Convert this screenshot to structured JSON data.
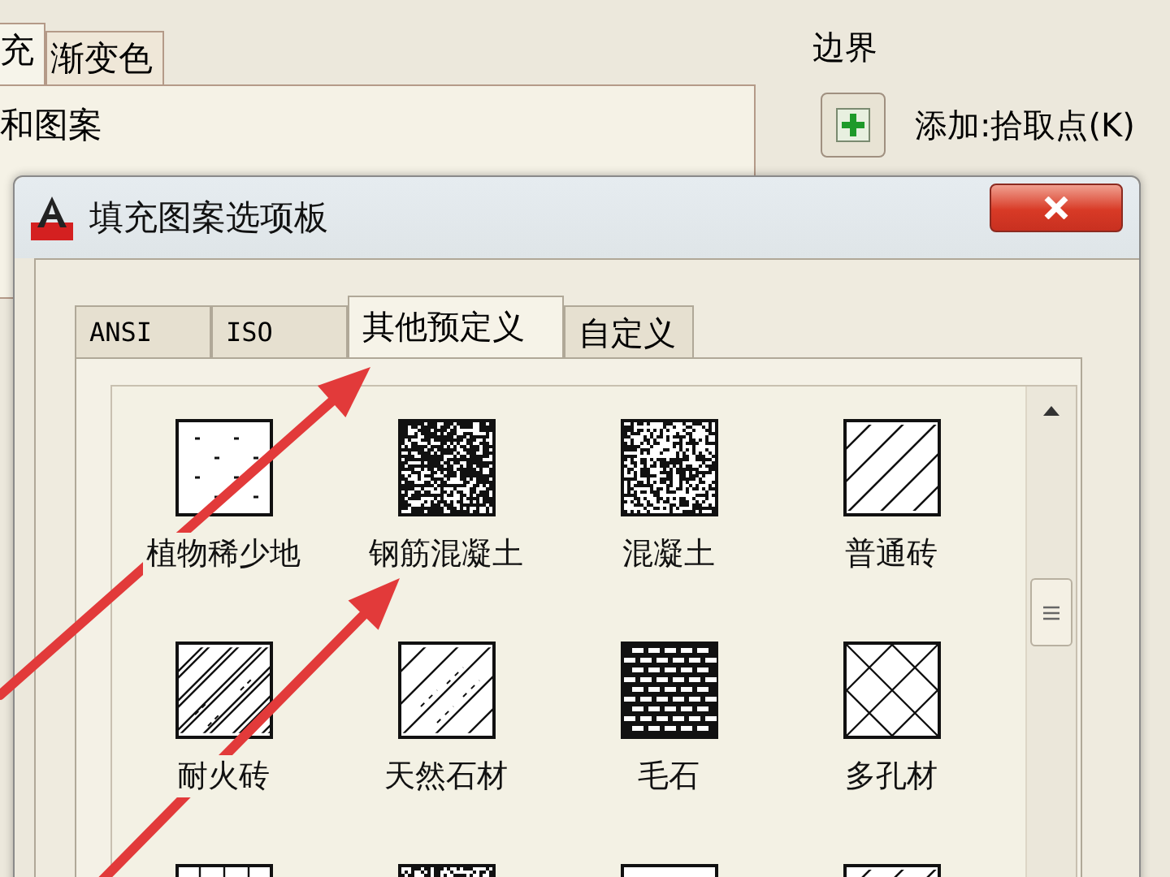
{
  "background_dialog": {
    "tabs": [
      {
        "label": "充",
        "selected": true
      },
      {
        "label": "渐变色",
        "selected": false
      }
    ],
    "group_title": "和图案",
    "boundary": {
      "title": "边界",
      "add_button_label": "添加:拾取点(K)"
    }
  },
  "palette": {
    "title": "填充图案选项板",
    "tabs": [
      {
        "label": "ANSI",
        "selected": false
      },
      {
        "label": "ISO",
        "selected": false
      },
      {
        "label": "其他预定义",
        "selected": true
      },
      {
        "label": "自定义",
        "selected": false
      }
    ],
    "patterns": [
      {
        "label": "植物稀少地",
        "kind": "sparse-dots"
      },
      {
        "label": "钢筋混凝土",
        "kind": "dense-noise"
      },
      {
        "label": "混凝土",
        "kind": "noise"
      },
      {
        "label": "普通砖",
        "kind": "diagonal"
      },
      {
        "label": "耐火砖",
        "kind": "double-diagonal"
      },
      {
        "label": "天然石材",
        "kind": "dashed-diagonal"
      },
      {
        "label": "毛石",
        "kind": "brick"
      },
      {
        "label": "多孔材",
        "kind": "crosshatch"
      },
      {
        "kind": "grid"
      },
      {
        "kind": "noise"
      },
      {
        "kind": "blank"
      },
      {
        "kind": "diagonal"
      }
    ]
  },
  "annotations": [
    {
      "kind": "arrow"
    },
    {
      "kind": "arrow"
    }
  ]
}
